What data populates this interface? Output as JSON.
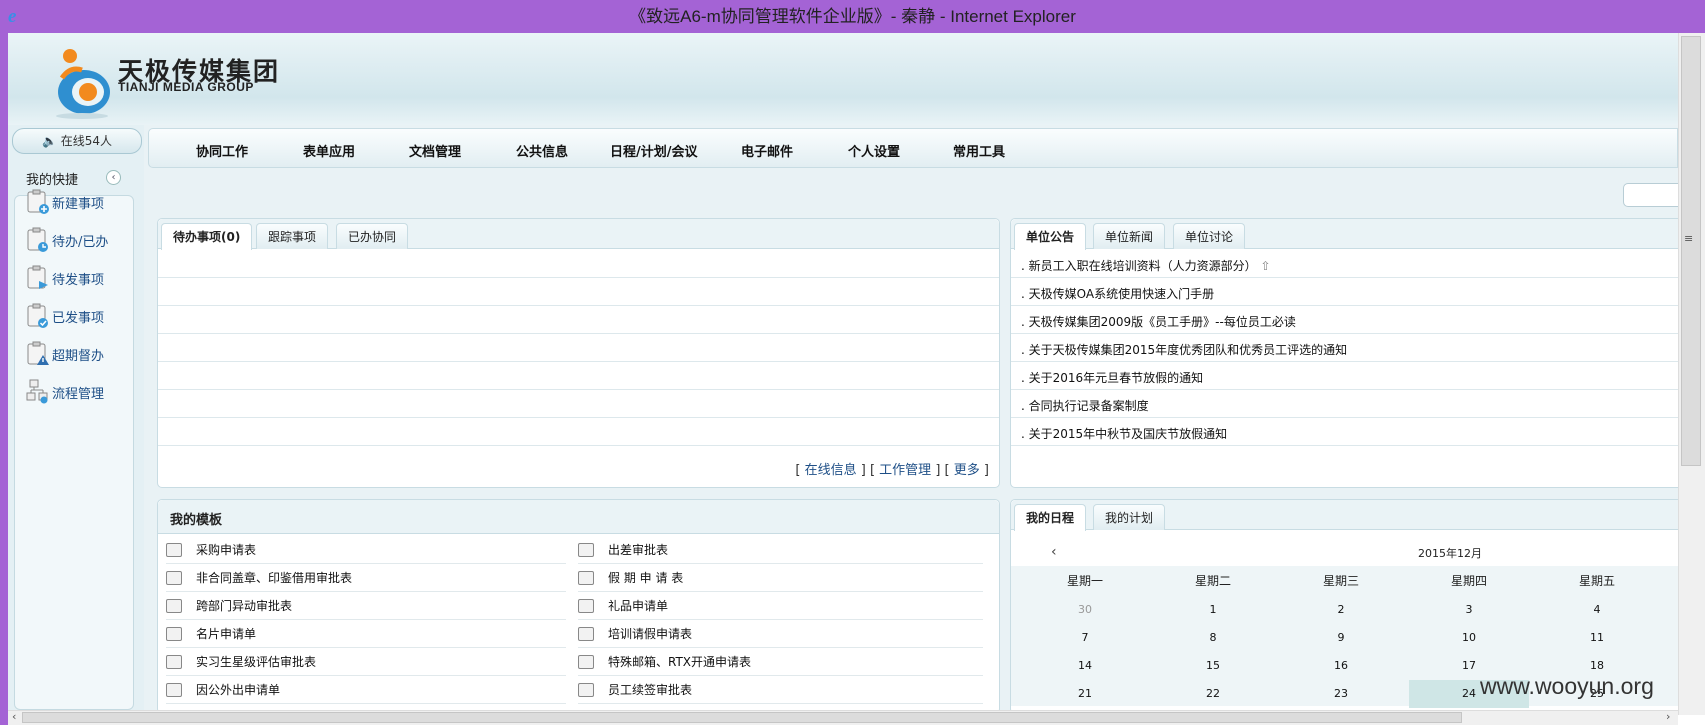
{
  "window": {
    "title": "《致远A6-m协同管理软件企业版》- 秦静 - Internet Explorer",
    "browser_icon": "ie-icon"
  },
  "logo": {
    "cn": "天极传媒集团",
    "en": "TIANJI MEDIA GROUP"
  },
  "sidebar": {
    "online": "在线54人",
    "title": "我的快捷",
    "collapse_icon": "‹",
    "items": [
      {
        "label": "新建事项",
        "icon": "new-item-icon"
      },
      {
        "label": "待办/已办",
        "icon": "clock-icon"
      },
      {
        "label": "待发事项",
        "icon": "send-pending-icon"
      },
      {
        "label": "已发事项",
        "icon": "sent-check-icon"
      },
      {
        "label": "超期督办",
        "icon": "warning-icon"
      },
      {
        "label": "流程管理",
        "icon": "workflow-icon"
      }
    ]
  },
  "nav": [
    "协同工作",
    "表单应用",
    "文档管理",
    "公共信息",
    "日程/计划/会议",
    "电子邮件",
    "个人设置",
    "常用工具"
  ],
  "pending": {
    "tabs": [
      "待办事项(0)",
      "跟踪事项",
      "已办协同"
    ],
    "links": [
      "在线信息",
      "工作管理",
      "更多"
    ]
  },
  "notices": {
    "tabs": [
      "单位公告",
      "单位新闻",
      "单位讨论"
    ],
    "items": [
      "新员工入职在线培训资料（人力资源部分）",
      "天极传媒OA系统使用快速入门手册",
      "天极传媒集团2009版《员工手册》--每位员工必读",
      "关于天极传媒集团2015年度优秀团队和优秀员工评选的通知",
      "关于2016年元旦春节放假的通知",
      "合同执行记录备案制度",
      "关于2015年中秋节及国庆节放假通知"
    ]
  },
  "templates": {
    "title": "我的模板",
    "left": [
      "采购申请表",
      "非合同盖章、印鉴借用审批表",
      "跨部门异动审批表",
      "名片申请单",
      "实习生星级评估审批表",
      "因公外出申请单"
    ],
    "right": [
      "出差审批表",
      "假 期 申 请 表",
      "礼品申请单",
      "培训请假申请表",
      "特殊邮箱、RTX开通申请表",
      "员工续签审批表"
    ]
  },
  "calendar": {
    "tabs": [
      "我的日程",
      "我的计划"
    ],
    "month": "2015年12月",
    "prev_icon": "‹",
    "weekdays": [
      "星期一",
      "星期二",
      "星期三",
      "星期四",
      "星期五"
    ],
    "weeks": [
      [
        "30",
        "1",
        "2",
        "3",
        "4"
      ],
      [
        "7",
        "8",
        "9",
        "10",
        "11"
      ],
      [
        "14",
        "15",
        "16",
        "17",
        "18"
      ],
      [
        "21",
        "22",
        "23",
        "24",
        "25"
      ]
    ],
    "today": "24",
    "today_color": "#cfe6e6"
  },
  "watermark": "www.wooyun.org",
  "colors": {
    "titlebar": "#a463d5",
    "link": "#1e4f87",
    "panel_border": "#c8dce3"
  }
}
